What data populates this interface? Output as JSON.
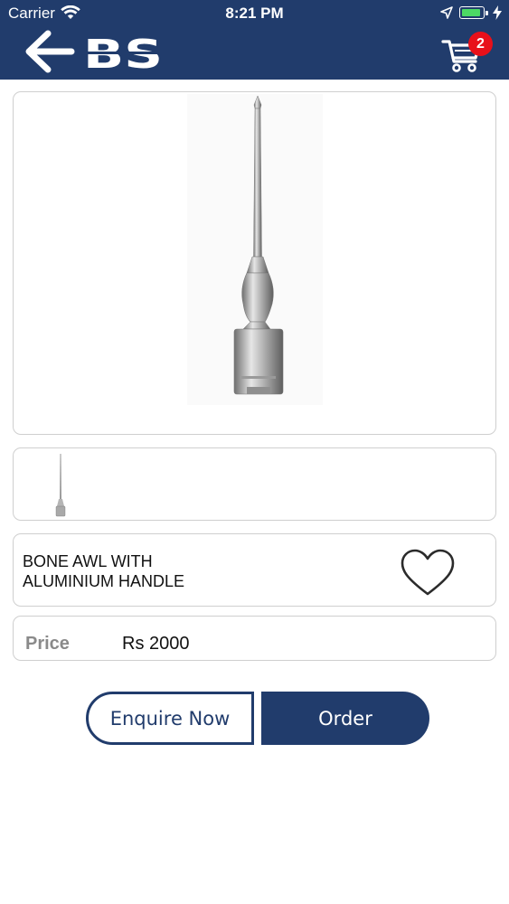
{
  "status_bar": {
    "carrier": "Carrier",
    "time": "8:21 PM"
  },
  "header": {
    "logo_text": "BS",
    "cart_count": "2",
    "background": "#213c6c",
    "badge_color": "#e8101a"
  },
  "product": {
    "title_line1": "BONE AWL WITH",
    "title_line2": "ALUMINIUM HANDLE",
    "price_label": "Price",
    "price_value": "Rs 2000",
    "thumbnail_count": 1
  },
  "actions": {
    "enquire_label": "Enquire Now",
    "order_label": "Order"
  },
  "icons": {
    "back": "back-arrow-icon",
    "cart": "cart-icon",
    "favorite": "heart-icon",
    "wifi": "wifi-icon",
    "location": "location-arrow-icon",
    "battery": "battery-icon",
    "charging": "bolt-icon"
  }
}
